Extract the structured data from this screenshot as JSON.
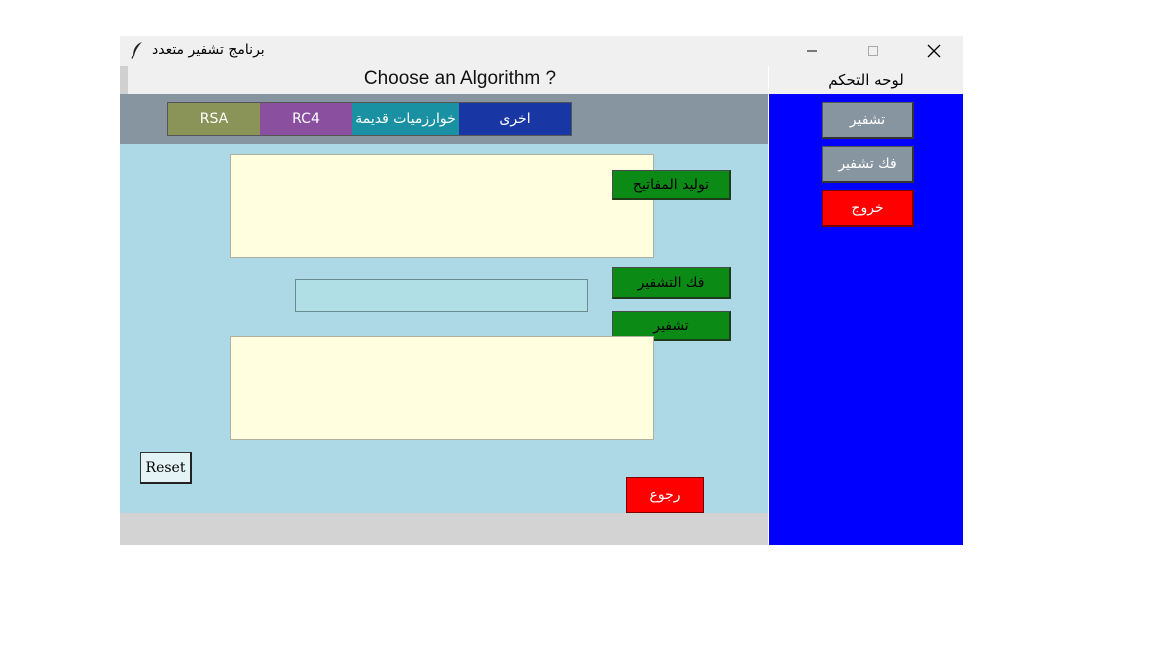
{
  "window": {
    "title": "برنامج تشفير متعدد",
    "icon": "feather-icon",
    "controls": [
      "minimize-icon",
      "maximize-icon",
      "close-icon"
    ]
  },
  "main": {
    "header": "Choose an Algorithm ?",
    "tabs": [
      {
        "label": "RSA",
        "color": "#8a9358"
      },
      {
        "label": "RC4",
        "color": "#8b4fa0"
      },
      {
        "label": "خوارزميات قديمة",
        "color": "#1a91a3"
      },
      {
        "label": "اخرى",
        "color": "#1837a5"
      }
    ],
    "input_text": "",
    "key_value": "",
    "output_text": "",
    "buttons": {
      "generate_keys": "توليد المفاتيح",
      "decrypt": "فك التشفير",
      "encrypt": "تشفير",
      "reset": "Reset",
      "back": "رجوع"
    }
  },
  "side_panel": {
    "title": "لوحه التحكم",
    "buttons": {
      "encrypt": "تشفير",
      "decrypt": "فك تشفير",
      "exit": "خروج"
    }
  },
  "colors": {
    "main_bg": "#add8e6",
    "side_bg": "#0000ff",
    "action_green": "#0b8a16",
    "danger_red": "#ff0000",
    "tab_bar": "#8795a1"
  }
}
